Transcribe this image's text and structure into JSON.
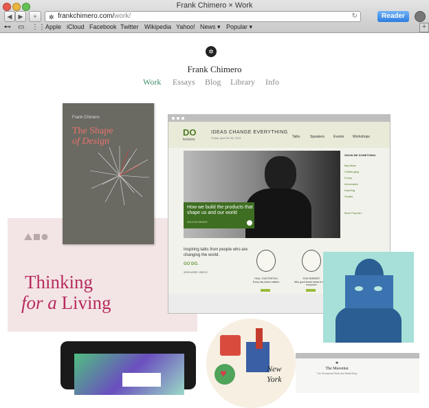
{
  "window": {
    "title": "Frank Chimero × Work"
  },
  "toolbar": {
    "back_label": "◀",
    "forward_label": "▶",
    "add_label": "+",
    "url_domain": "frankchimero.com/",
    "url_path": "work/",
    "reader_label": "Reader"
  },
  "bookmarks": [
    {
      "label": "Apple"
    },
    {
      "label": "iCloud"
    },
    {
      "label": "Facebook"
    },
    {
      "label": "Twitter"
    },
    {
      "label": "Wikipedia"
    },
    {
      "label": "Yahoo!"
    },
    {
      "label": "News ▾"
    },
    {
      "label": "Popular ▾"
    }
  ],
  "site": {
    "name": "Frank Chimero",
    "nav": [
      {
        "label": "Work",
        "active": true
      },
      {
        "label": "Essays"
      },
      {
        "label": "Blog"
      },
      {
        "label": "Library"
      },
      {
        "label": "Info"
      }
    ]
  },
  "book": {
    "author": "Frank Chimero",
    "title_line1": "The Shape",
    "title_line2": "of Design"
  },
  "thinking": {
    "line1": "Thinking",
    "line2_pre": "for",
    "line2_a": "a",
    "line2_post": "Living"
  },
  "do_lectures": {
    "logo": "DO",
    "logo_sub": "lectures",
    "tagline": "IDEAS CHANGE EVERYTHING",
    "date": "Friday, April 26-28, 2013",
    "nav": [
      "Talks",
      "Speakers",
      "Events",
      "Workshops"
    ],
    "hero_caption": "How we build the products that shape us and our world",
    "hero_speaker": "WILSON MINER",
    "side_heading": "SHOW ME SOMETHING:",
    "side_items": [
      "Big Ideas",
      "Challenging",
      "Funny",
      "Informative",
      "Inspiring",
      "Soulful"
    ],
    "side_more": "More Popular ›",
    "inspiring": "Inspiring talks from people who are changing the world.",
    "go_do": "GO DO.",
    "view_more": "VIEW MORE VIDEOS",
    "speakers": [
      {
        "name": "PAUL CHATTERTON",
        "talk": "Every day action matters"
      },
      {
        "name": "TOM HERBERT",
        "talk": "Why good bread needs to be for everyone!"
      }
    ]
  },
  "maverist": {
    "title": "The Mavenist",
    "sub": "The Occasional Rank and Walks Blog"
  },
  "circle": {
    "text": "New York"
  }
}
